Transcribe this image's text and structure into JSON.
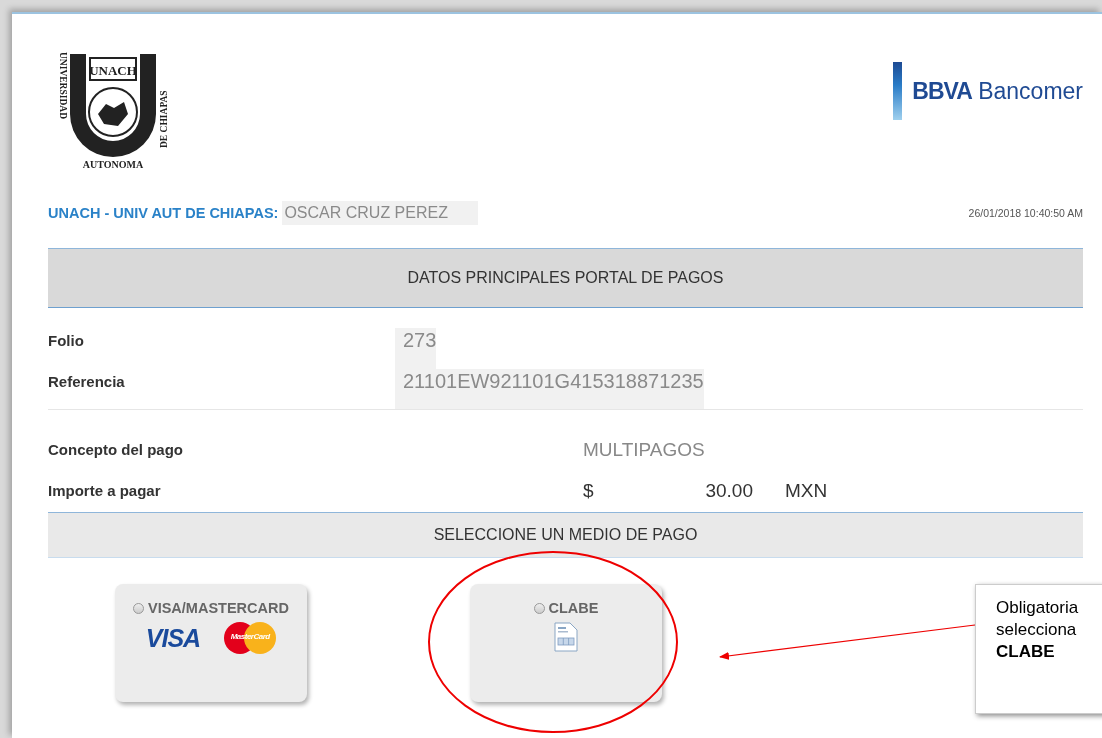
{
  "logo": {
    "top": "UNACH",
    "left": "UNIVERSIDAD",
    "right": "DE CHIAPAS",
    "bottom": "AUTONOMA"
  },
  "bank_logo": {
    "strong": "BBVA",
    "name": "Bancomer"
  },
  "header": {
    "institution": "UNACH - UNIV AUT DE CHIAPAS:",
    "customer": "OSCAR CRUZ PEREZ",
    "timestamp": "26/01/2018 10:40:50 AM"
  },
  "main_section": {
    "title": "DATOS PRINCIPALES PORTAL DE PAGOS"
  },
  "details": [
    {
      "label": "Folio",
      "value": "273"
    },
    {
      "label": "Referencia",
      "value": "21101EW921101G415318871235"
    }
  ],
  "payment": {
    "concept_label": "Concepto del pago",
    "concept": "MULTIPAGOS",
    "amount_label": "Importe a pagar",
    "currency_symbol": "$",
    "amount": "30.00",
    "currency": "MXN"
  },
  "method_section": {
    "title": "SELECCIONE UN MEDIO DE PAGO"
  },
  "methods": [
    {
      "kind": "cards",
      "label": "VISA/MASTERCARD",
      "selected": false,
      "visa": "VISA",
      "mastercard": "MasterCard"
    },
    {
      "kind": "clabe",
      "label": "CLABE",
      "selected": false
    }
  ],
  "callout": {
    "lines": [
      "Obligatoria",
      "selecciona"
    ],
    "bold": "CLABE"
  }
}
